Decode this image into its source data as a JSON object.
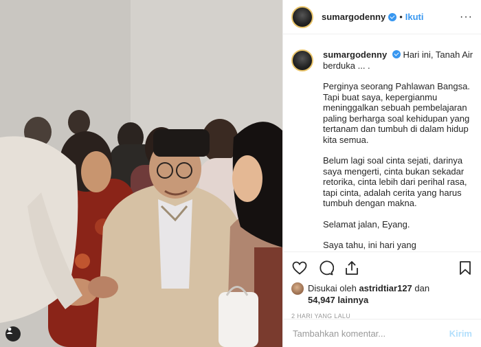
{
  "post": {
    "username": "sumargodenny",
    "follow_label": "Ikuti",
    "more_label": "···",
    "caption_username": "sumargodenny",
    "caption": [
      "Hari ini, Tanah Air berduka ... .",
      "Perginya seorang Pahlawan Bangsa. Tapi buat saya, kepergianmu meninggalkan sebuah pembelajaran paling berharga soal kehidupan yang tertanam dan tumbuh di dalam hidup kita semua.",
      "Belum lagi soal cinta sejati, darinya saya mengerti, cinta bukan sekadar retorika, cinta lebih dari perihal rasa, tapi cinta, adalah cerita yang harus tumbuh dengan makna.",
      "Selamat jalan, Eyang.",
      "Saya tahu, ini hari yang menenangkan bagimu, untuk akhirnya pergi dalam"
    ]
  },
  "likes": {
    "prefix": "Disukai oleh",
    "user": "astridtiar127",
    "connector": "dan",
    "count": "54,947 lainnya"
  },
  "timestamp": "2 HARI YANG LALU",
  "comment": {
    "placeholder": "Tambahkan komentar...",
    "send_label": "Kirim"
  },
  "icons": {
    "verified": "verified-badge-icon",
    "like": "heart-icon",
    "comment": "comment-icon",
    "share": "share-icon",
    "save": "bookmark-icon",
    "user_tag": "person-icon"
  },
  "colors": {
    "accent": "#3897f0",
    "send_disabled": "#b2dffc",
    "muted": "#999999",
    "border": "#efefef"
  }
}
